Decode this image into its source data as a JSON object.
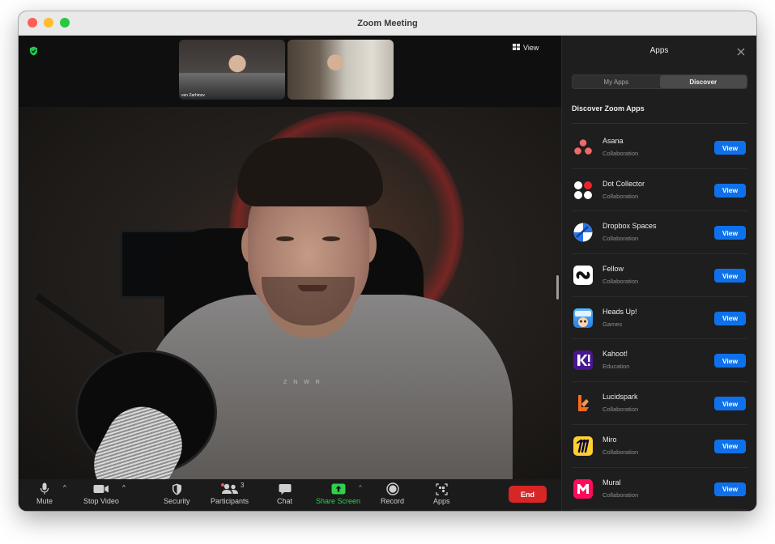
{
  "window": {
    "title": "Zoom Meeting"
  },
  "meeting": {
    "view_label": "View",
    "thumbnails": [
      {
        "name": "ven Zarhinov"
      },
      {
        "name": ""
      }
    ],
    "shirt_text": "Z N W R"
  },
  "toolbar": {
    "mute": "Mute",
    "stop_video": "Stop Video",
    "security": "Security",
    "participants": "Participants",
    "participants_count": "3",
    "chat": "Chat",
    "share_screen": "Share Screen",
    "record": "Record",
    "apps": "Apps",
    "end": "End",
    "caret": "^"
  },
  "panel": {
    "title": "Apps",
    "tabs": [
      {
        "label": "My Apps",
        "active": false
      },
      {
        "label": "Discover",
        "active": true
      }
    ],
    "section_title": "Discover Zoom Apps",
    "view_label": "View",
    "apps": [
      {
        "name": "Asana",
        "category": "Collaboration",
        "icon": "asana-icon"
      },
      {
        "name": "Dot Collector",
        "category": "Collaboration",
        "icon": "dot-collector-icon"
      },
      {
        "name": "Dropbox Spaces",
        "category": "Collaboration",
        "icon": "dropbox-spaces-icon"
      },
      {
        "name": "Fellow",
        "category": "Collaboration",
        "icon": "fellow-icon"
      },
      {
        "name": "Heads Up!",
        "category": "Games",
        "icon": "heads-up-icon"
      },
      {
        "name": "Kahoot!",
        "category": "Education",
        "icon": "kahoot-icon"
      },
      {
        "name": "Lucidspark",
        "category": "Collaboration",
        "icon": "lucidspark-icon"
      },
      {
        "name": "Miro",
        "category": "Collaboration",
        "icon": "miro-icon"
      },
      {
        "name": "Mural",
        "category": "Collaboration",
        "icon": "mural-icon"
      }
    ]
  },
  "colors": {
    "accent_blue": "#0e71eb",
    "end_red": "#d72626",
    "share_green": "#2fd14c",
    "panel_bg": "#1e1e1e"
  }
}
